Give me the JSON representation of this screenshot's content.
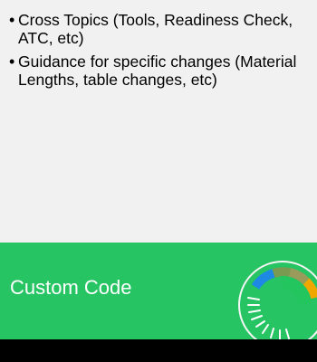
{
  "card": {
    "bullets": [
      "Cross Topics (Tools, Readiness Check, ATC, etc)",
      "Guidance for specific changes (Material Lengths, table changes, etc)"
    ],
    "title": "Custom Code"
  },
  "colors": {
    "panel_bg": "#f1f1f1",
    "accent_green": "#26c463",
    "ring_blue": "#1e88e5",
    "ring_olive": "#7a9a52",
    "ring_tan": "#9a9a5a",
    "ring_orange": "#f0a800",
    "ring_green": "#22c55e",
    "background": "#000000"
  },
  "icons": {
    "ring": "progress-ring-icon"
  }
}
